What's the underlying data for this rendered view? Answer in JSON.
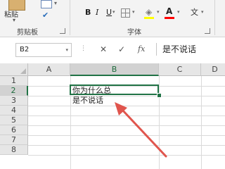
{
  "ribbon": {
    "paste_label": "粘贴",
    "clipboard_group": "剪贴板",
    "font_group": "字体",
    "bold": "B",
    "italic": "I",
    "underline": "U",
    "font_color_glyph": "A",
    "wen_glyph": "wén\n文"
  },
  "formula_bar": {
    "name_box": "B2",
    "content": "是不说话"
  },
  "sheet": {
    "columns": [
      "A",
      "B",
      "C",
      "D"
    ],
    "rows": [
      "1",
      "2",
      "3",
      "4",
      "5",
      "6",
      "7",
      "8"
    ],
    "selected_cell": "B2",
    "cells": {
      "B2_line1": "你为什么总",
      "B2_line2": "是不说话"
    }
  },
  "annotation": {
    "arrow_color": "#e0554d"
  },
  "colors": {
    "excel_green": "#217346",
    "fill_color": "#ffff00",
    "font_color": "#ff0000"
  }
}
